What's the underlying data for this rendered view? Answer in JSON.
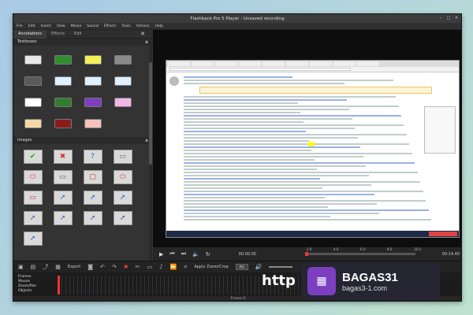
{
  "window": {
    "title": "Flashback Pro 5 Player - Unsaved recording"
  },
  "menu": [
    "File",
    "Edit",
    "Insert",
    "View",
    "Movie",
    "Sound",
    "Effects",
    "Tools",
    "Actions",
    "Help"
  ],
  "left_tabs": [
    "Annotations",
    "Effects",
    "Edit"
  ],
  "sections": {
    "textboxes": "Textboxes",
    "images": "Images"
  },
  "textbox_colors": [
    "#e8e8e8",
    "#2f8f2f",
    "#f5ef5a",
    "#8a8a8a",
    "#5a5a5a",
    "#e0f0ff",
    "#e0f0ff",
    "#e0f0ff",
    "#ffffff",
    "#2f7d2f",
    "#7b3fbf",
    "#f0b7e6",
    "#f4d9a6",
    "#8a1c1c",
    "#f5c3bd"
  ],
  "image_icons": [
    "check-icon",
    "cross-icon",
    "question-icon",
    "rect-icon",
    "ellipse-icon",
    "rect-icon",
    "rounded-rect-icon",
    "ellipse-icon",
    "rect-red-icon",
    "arrow-icon",
    "arrow-icon",
    "arrow-icon",
    "arrow-icon",
    "arrow-icon",
    "arrow-icon",
    "arrow-icon",
    "arrow-icon"
  ],
  "transport": {
    "time_left": "00:00.00",
    "time_right": "00:14.40",
    "ticks": [
      "2.0",
      "4.0",
      "6.0",
      "8.0",
      "10.0"
    ]
  },
  "toolbar": {
    "export": "Export",
    "apply_zoom": "Apply Zoom/Crop",
    "zoom_value": "Fit"
  },
  "timeline_tracks": [
    "Frames",
    "Mouse",
    "Zoom/Pan",
    "Objects"
  ],
  "status": "Frame 0",
  "watermark": {
    "url_text": "http",
    "brand": "BAGAS31",
    "site": "bagas3-1.com"
  }
}
